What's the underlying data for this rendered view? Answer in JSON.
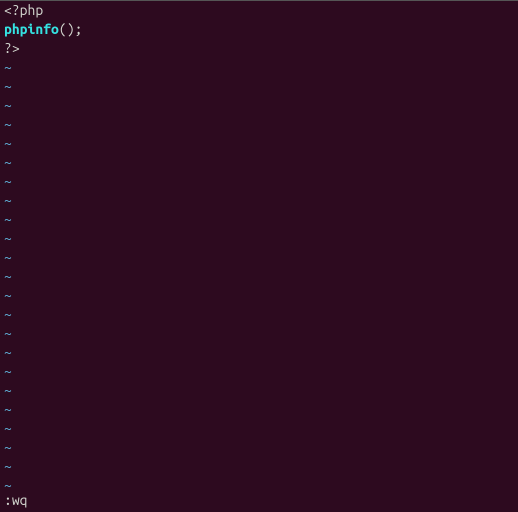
{
  "code": {
    "line1_open": "<?php",
    "line2_func": "phpinfo",
    "line2_parens": "()",
    "line2_semi": ";",
    "line3_close": "?>"
  },
  "tilde_char": "~",
  "tilde_count": 23,
  "command": ":wq"
}
